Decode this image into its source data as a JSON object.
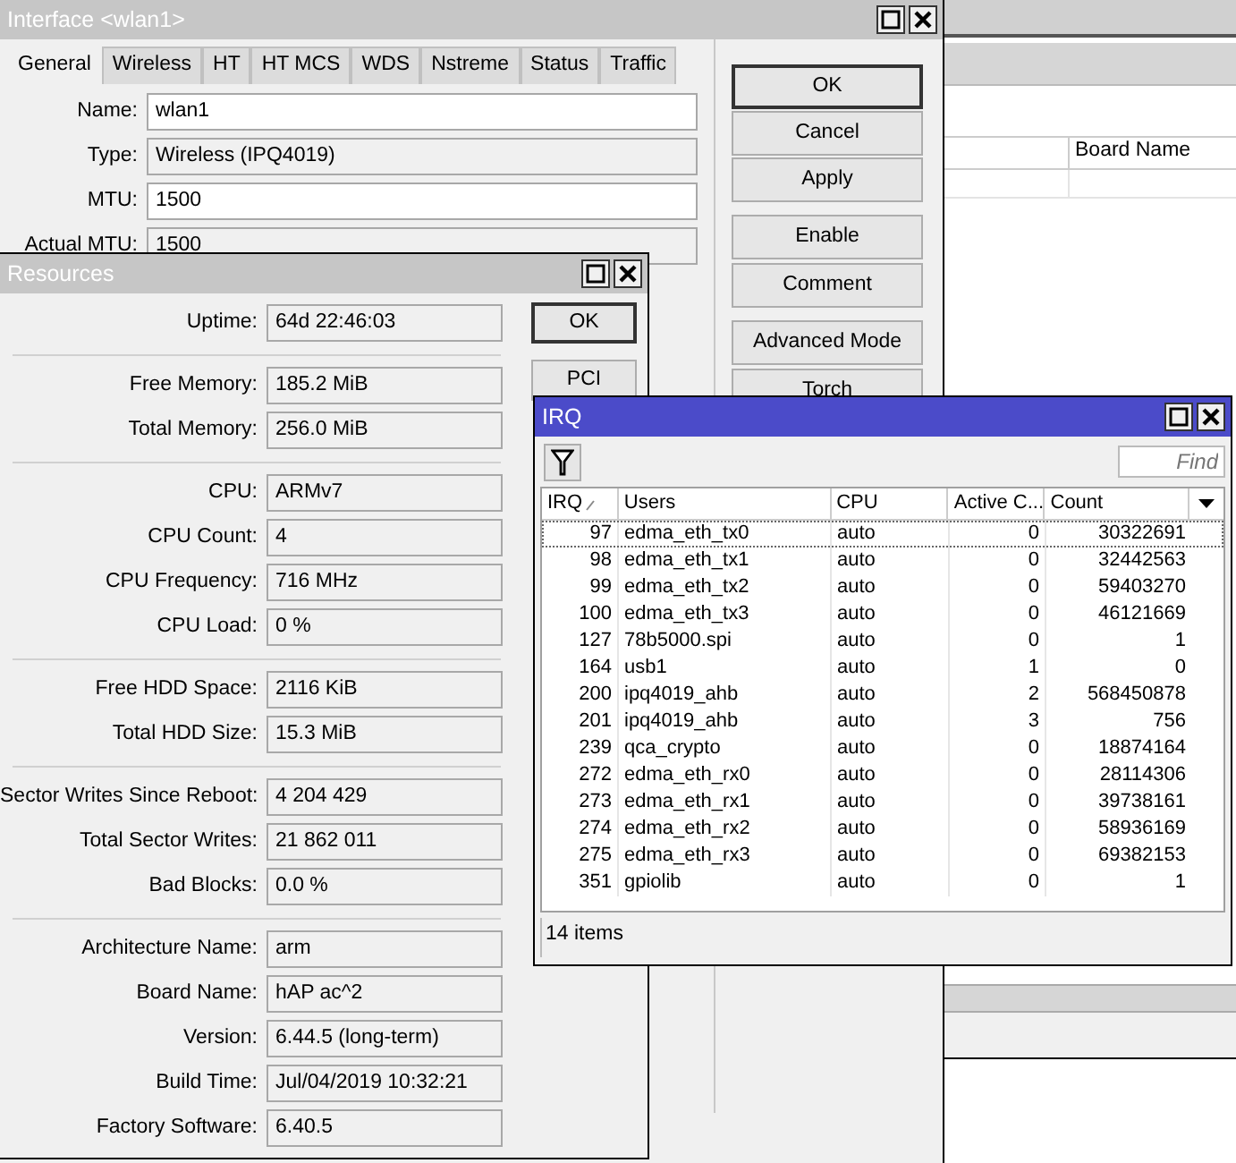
{
  "interface_window": {
    "title": "Interface <wlan1>",
    "active": false,
    "tabs": [
      {
        "label": "General",
        "selected": true
      },
      {
        "label": "Wireless",
        "selected": false
      },
      {
        "label": "HT",
        "selected": false
      },
      {
        "label": "HT MCS",
        "selected": false
      },
      {
        "label": "WDS",
        "selected": false
      },
      {
        "label": "Nstreme",
        "selected": false
      },
      {
        "label": "Status",
        "selected": false
      },
      {
        "label": "Traffic",
        "selected": false
      }
    ],
    "fields": [
      {
        "label": "Name:",
        "value": "wlan1",
        "readonly": false
      },
      {
        "label": "Type:",
        "value": "Wireless (IPQ4019)",
        "readonly": true
      },
      {
        "label": "MTU:",
        "value": "1500",
        "readonly": false
      },
      {
        "label": "Actual MTU:",
        "value": "1500",
        "readonly": true
      }
    ],
    "buttons": [
      {
        "label": "OK",
        "default": true
      },
      {
        "label": "Cancel",
        "default": false
      },
      {
        "label": "Apply",
        "default": false
      },
      {
        "label": "Enable",
        "default": false
      },
      {
        "label": "Comment",
        "default": false
      },
      {
        "label": "Advanced Mode",
        "default": false
      },
      {
        "label": "Torch",
        "default": false
      }
    ]
  },
  "background_window": {
    "columns": [
      "Board Name"
    ]
  },
  "resources_window": {
    "title": "Resources",
    "active": false,
    "groups": [
      [
        {
          "label": "Uptime:",
          "value": "64d 22:46:03"
        }
      ],
      [
        {
          "label": "Free Memory:",
          "value": "185.2 MiB"
        },
        {
          "label": "Total Memory:",
          "value": "256.0 MiB"
        }
      ],
      [
        {
          "label": "CPU:",
          "value": "ARMv7"
        },
        {
          "label": "CPU Count:",
          "value": "4"
        },
        {
          "label": "CPU Frequency:",
          "value": "716 MHz"
        },
        {
          "label": "CPU Load:",
          "value": "0 %"
        }
      ],
      [
        {
          "label": "Free HDD Space:",
          "value": "2116 KiB"
        },
        {
          "label": "Total HDD Size:",
          "value": "15.3 MiB"
        }
      ],
      [
        {
          "label": "Sector Writes Since Reboot:",
          "value": "4 204 429"
        },
        {
          "label": "Total Sector Writes:",
          "value": "21 862 011"
        },
        {
          "label": "Bad Blocks:",
          "value": "0.0 %"
        }
      ],
      [
        {
          "label": "Architecture Name:",
          "value": "arm"
        },
        {
          "label": "Board Name:",
          "value": "hAP ac^2"
        },
        {
          "label": "Version:",
          "value": "6.44.5 (long-term)"
        },
        {
          "label": "Build Time:",
          "value": "Jul/04/2019 10:32:21"
        },
        {
          "label": "Factory Software:",
          "value": "6.40.5"
        }
      ]
    ],
    "buttons": [
      {
        "label": "OK",
        "default": true
      },
      {
        "label": "PCI",
        "default": false
      }
    ]
  },
  "irq_window": {
    "title": "IRQ",
    "active": true,
    "find_placeholder": "Find",
    "columns": [
      {
        "label": "IRQ",
        "sorted": true
      },
      {
        "label": "Users",
        "sorted": false
      },
      {
        "label": "CPU",
        "sorted": false
      },
      {
        "label": "Active C...",
        "sorted": false
      },
      {
        "label": "Count",
        "sorted": false
      }
    ],
    "rows": [
      {
        "irq": "97",
        "users": "edma_eth_tx0",
        "cpu": "auto",
        "active_cpu": "0",
        "count": "30322691",
        "focused": true
      },
      {
        "irq": "98",
        "users": "edma_eth_tx1",
        "cpu": "auto",
        "active_cpu": "0",
        "count": "32442563",
        "focused": false
      },
      {
        "irq": "99",
        "users": "edma_eth_tx2",
        "cpu": "auto",
        "active_cpu": "0",
        "count": "59403270",
        "focused": false
      },
      {
        "irq": "100",
        "users": "edma_eth_tx3",
        "cpu": "auto",
        "active_cpu": "0",
        "count": "46121669",
        "focused": false
      },
      {
        "irq": "127",
        "users": "78b5000.spi",
        "cpu": "auto",
        "active_cpu": "0",
        "count": "1",
        "focused": false
      },
      {
        "irq": "164",
        "users": "usb1",
        "cpu": "auto",
        "active_cpu": "1",
        "count": "0",
        "focused": false
      },
      {
        "irq": "200",
        "users": "ipq4019_ahb",
        "cpu": "auto",
        "active_cpu": "2",
        "count": "568450878",
        "focused": false
      },
      {
        "irq": "201",
        "users": "ipq4019_ahb",
        "cpu": "auto",
        "active_cpu": "3",
        "count": "756",
        "focused": false
      },
      {
        "irq": "239",
        "users": "qca_crypto",
        "cpu": "auto",
        "active_cpu": "0",
        "count": "18874164",
        "focused": false
      },
      {
        "irq": "272",
        "users": "edma_eth_rx0",
        "cpu": "auto",
        "active_cpu": "0",
        "count": "28114306",
        "focused": false
      },
      {
        "irq": "273",
        "users": "edma_eth_rx1",
        "cpu": "auto",
        "active_cpu": "0",
        "count": "39738161",
        "focused": false
      },
      {
        "irq": "274",
        "users": "edma_eth_rx2",
        "cpu": "auto",
        "active_cpu": "0",
        "count": "58936169",
        "focused": false
      },
      {
        "irq": "275",
        "users": "edma_eth_rx3",
        "cpu": "auto",
        "active_cpu": "0",
        "count": "69382153",
        "focused": false
      },
      {
        "irq": "351",
        "users": "gpiolib",
        "cpu": "auto",
        "active_cpu": "0",
        "count": "1",
        "focused": false
      }
    ],
    "status": "14 items"
  }
}
